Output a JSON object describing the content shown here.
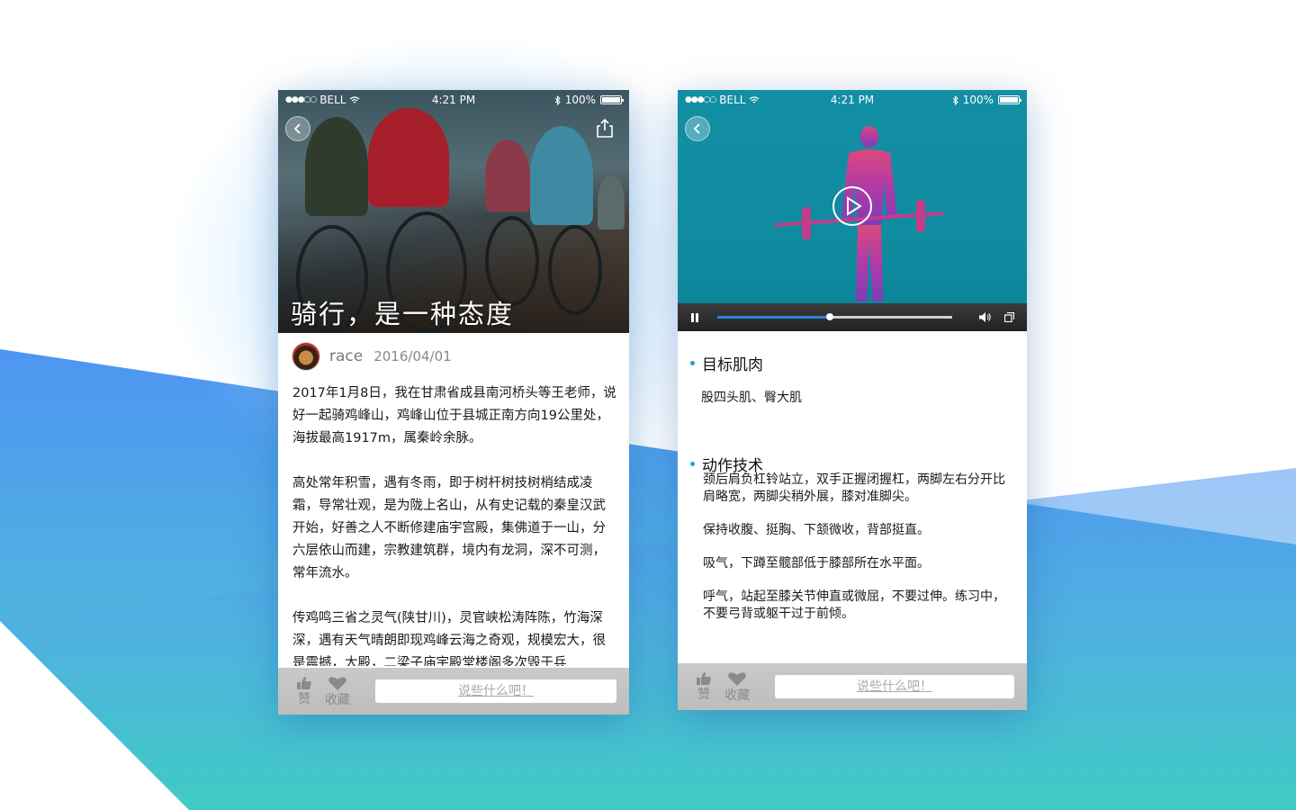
{
  "colors": {
    "accent_blue": "#2a9fd6",
    "video_teal": "#138ea4",
    "action_bar_gray": "#c4c4c4"
  },
  "left_phone": {
    "status_bar": {
      "signal": "●●●○○",
      "carrier": "BELL",
      "time": "4:21 PM",
      "battery": "100%",
      "battery_level": 1.0
    },
    "hero": {
      "title": "骑行，是一种态度",
      "back_icon": "chevron-left-icon",
      "share_icon": "share-icon"
    },
    "author": {
      "name": "race",
      "date": "2016/04/01"
    },
    "article": {
      "paragraphs": [
        " 2017年1月8日，我在甘肃省成县南河桥头等王老师，说好一起骑鸡峰山，鸡峰山位于县城正南方向19公里处，海拔最高1917m，属秦岭余脉。",
        "高处常年积雪，遇有冬雨，即于树杆树技树梢结成凌霜，导常壮观，是为陇上名山，从有史记载的秦皇汉武开始，好善之人不断修建庙宇宫殿，集佛道于一山，分六层依山而建，宗教建筑群，境内有龙洞，深不可测，常年流水。",
        "传鸡鸣三省之灵气(陕甘川)，灵官峡松涛阵陈，竹海深深，遇有天气晴朗即现鸡峰云海之奇观，规模宏大，很是震撼，大殿，二梁子庙宇殿堂楼阁多次毁于兵"
      ]
    },
    "action_bar": {
      "like_label": "赞",
      "favorite_label": "收藏",
      "comment_placeholder": "说些什么吧！"
    }
  },
  "right_phone": {
    "status_bar": {
      "signal": "●●●○○",
      "carrier": "BELL",
      "time": "4:21 PM",
      "battery": "100%",
      "battery_level": 1.0
    },
    "video": {
      "back_icon": "chevron-left-icon",
      "play_icon": "play-icon",
      "progress": 0.48
    },
    "target_muscle": {
      "heading": "目标肌肉",
      "text": "股四头肌、臀大肌"
    },
    "technique": {
      "heading": "动作技术",
      "steps": [
        "颈后肩负杠铃站立，双手正握闭握杠，两脚左右分开比肩略宽，两脚尖稍外展，膝对准脚尖。",
        "保持收腹、挺胸、下颔微收，背部挺直。",
        "吸气，下蹲至髋部低于膝部所在水平面。",
        "呼气，站起至膝关节伸直或微屈，不要过伸。练习中，不要弓背或躯干过于前倾。"
      ]
    },
    "action_bar": {
      "like_label": "赞",
      "favorite_label": "收藏",
      "comment_placeholder": "说些什么吧！"
    }
  }
}
